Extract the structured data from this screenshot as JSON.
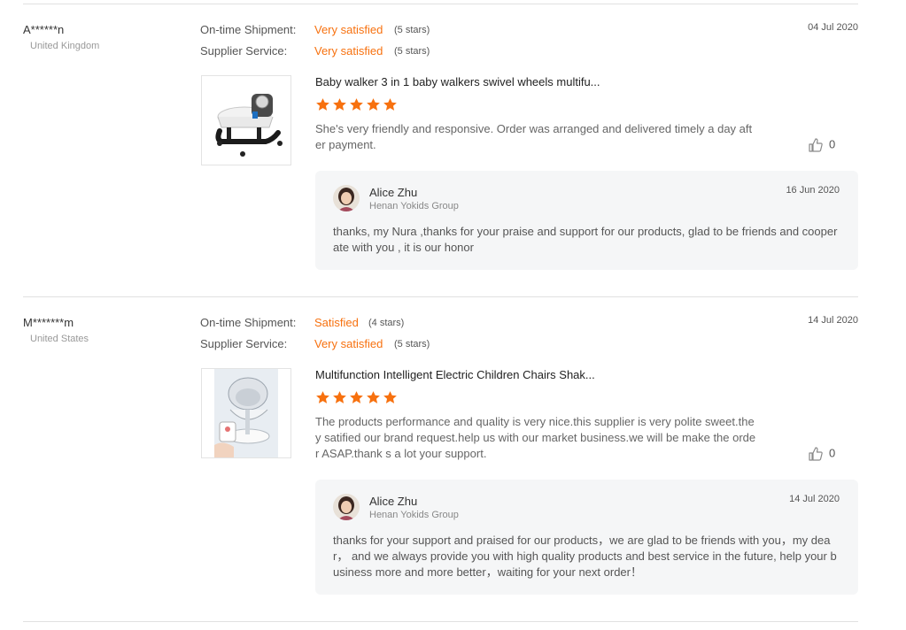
{
  "labels": {
    "on_time_shipment": "On-time Shipment:",
    "supplier_service": "Supplier Service:"
  },
  "reviews": [
    {
      "buyer_name": "A******n",
      "buyer_country": "United Kingdom",
      "date": "04 Jul 2020",
      "on_time_shipment": {
        "value": "Very satisfied",
        "stars": "(5 stars)"
      },
      "supplier_service": {
        "value": "Very satisfied",
        "stars": "(5 stars)"
      },
      "product_title": "Baby walker 3 in 1 baby walkers swivel wheels multifu...",
      "rating": 5,
      "text": "She's very friendly and responsive. Order was arranged and delivered timely a day after payment.",
      "likes": "0",
      "reply": {
        "name": "Alice Zhu",
        "company": "Henan Yokids Group",
        "date": "16 Jun 2020",
        "text": "thanks, my Nura ,thanks for your praise and support for our products, glad to be friends and cooperate with you , it is our honor"
      }
    },
    {
      "buyer_name": "M*******m",
      "buyer_country": "United States",
      "date": "14 Jul 2020",
      "on_time_shipment": {
        "value": "Satisfied",
        "stars": "(4 stars)"
      },
      "supplier_service": {
        "value": "Very satisfied",
        "stars": "(5 stars)"
      },
      "product_title": "Multifunction Intelligent Electric Children Chairs Shak...",
      "rating": 5,
      "text": "The products performance and quality is very nice.this supplier is very polite sweet.they satified our brand request.help us with our market business.we will be make the order ASAP.thank s a lot your support.",
      "likes": "0",
      "reply": {
        "name": "Alice Zhu",
        "company": "Henan Yokids Group",
        "date": "14 Jul 2020",
        "text": "thanks for your support and praised for our products，we are glad to be friends with you，my dear， and we always provide you with high quality products and best service in the future, help your business more and more better，waiting for your next order！"
      }
    }
  ],
  "colors": {
    "accent": "#f7710f",
    "divider": "#e1e1e1",
    "reply_bg": "#f5f6f7"
  },
  "icons": {
    "star": "star-icon",
    "thumb": "thumbs-up-icon"
  }
}
